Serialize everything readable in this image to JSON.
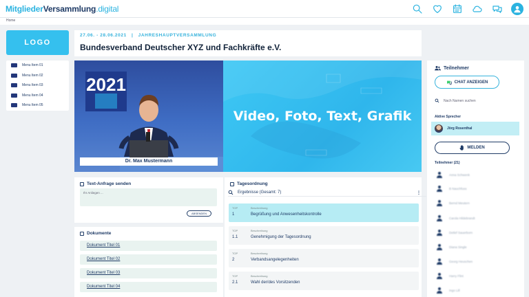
{
  "brand": {
    "part1": "Mitglieder",
    "part2": "Versammlung",
    "part3": ".digital"
  },
  "top_icons": [
    "search-icon",
    "heart-icon",
    "calendar-icon",
    "cloud-icon",
    "chat-icon",
    "user-avatar-icon"
  ],
  "breadcrumb": "Home",
  "logo": "LOGO",
  "menu": [
    "Menu Item 01",
    "Menu Item 02",
    "Menu Item 03",
    "Menu Item 04",
    "Menu Item 05"
  ],
  "event": {
    "dates": "27.06. - 28.06.2021",
    "separator": "|",
    "type": "JAHRESHAUPTVERSAMMLUNG",
    "title": "Bundesverband Deutscher XYZ und Fachkräfte e.V."
  },
  "media": {
    "speaker": "Dr. Max Mustermann",
    "year": "2021",
    "placeholder": "Video, Foto, Text, Grafik"
  },
  "text_request": {
    "title": "Text-Anfrage senden",
    "placeholder": "Ihr Anliegen ...",
    "send": "ABSENDEN"
  },
  "documents": {
    "title": "Dokumente",
    "items": [
      "Dokument Titel 01",
      "Dokument Titel 02",
      "Dokument Titel 03",
      "Dokument Titel 04"
    ]
  },
  "agenda": {
    "title": "Tagesordnung",
    "results": "Ergebnisse (Gesamt: 7)",
    "top_label": "TOP",
    "desc_label": "Beschreibung",
    "items": [
      {
        "num": "1",
        "text": "Begrüßung und Anwesenheitskontrolle",
        "active": true
      },
      {
        "num": "1.1",
        "text": "Genehmigung der Tagesordnung",
        "active": false
      },
      {
        "num": "2",
        "text": "Verbandsangelegenheiten",
        "active": false
      },
      {
        "num": "2.1",
        "text": "Wahl der/des Vorsitzenden",
        "active": false
      }
    ]
  },
  "participants": {
    "title": "Teilnehmer",
    "chat_button": "CHAT ANZEIGEN",
    "search_placeholder": "Nach Namen suchen",
    "active_label": "Aktive Sprecher",
    "active_speaker": "Jörg Rosenthal",
    "report_button": "MELDEN",
    "list_label": "Teilnehmer (21)",
    "names": [
      "Anna Schwenk",
      "B Nauchfuss",
      "Bernd Meutern",
      "Carola Hildebrandt",
      "Detlef Sauerborn",
      "Diana Single",
      "Georg Heuschen",
      "Harry Flint",
      "Ingo Lill"
    ]
  },
  "colors": {
    "accent": "#2bb3e0",
    "navy": "#1f3b66",
    "highlight": "#b6ecf4"
  }
}
